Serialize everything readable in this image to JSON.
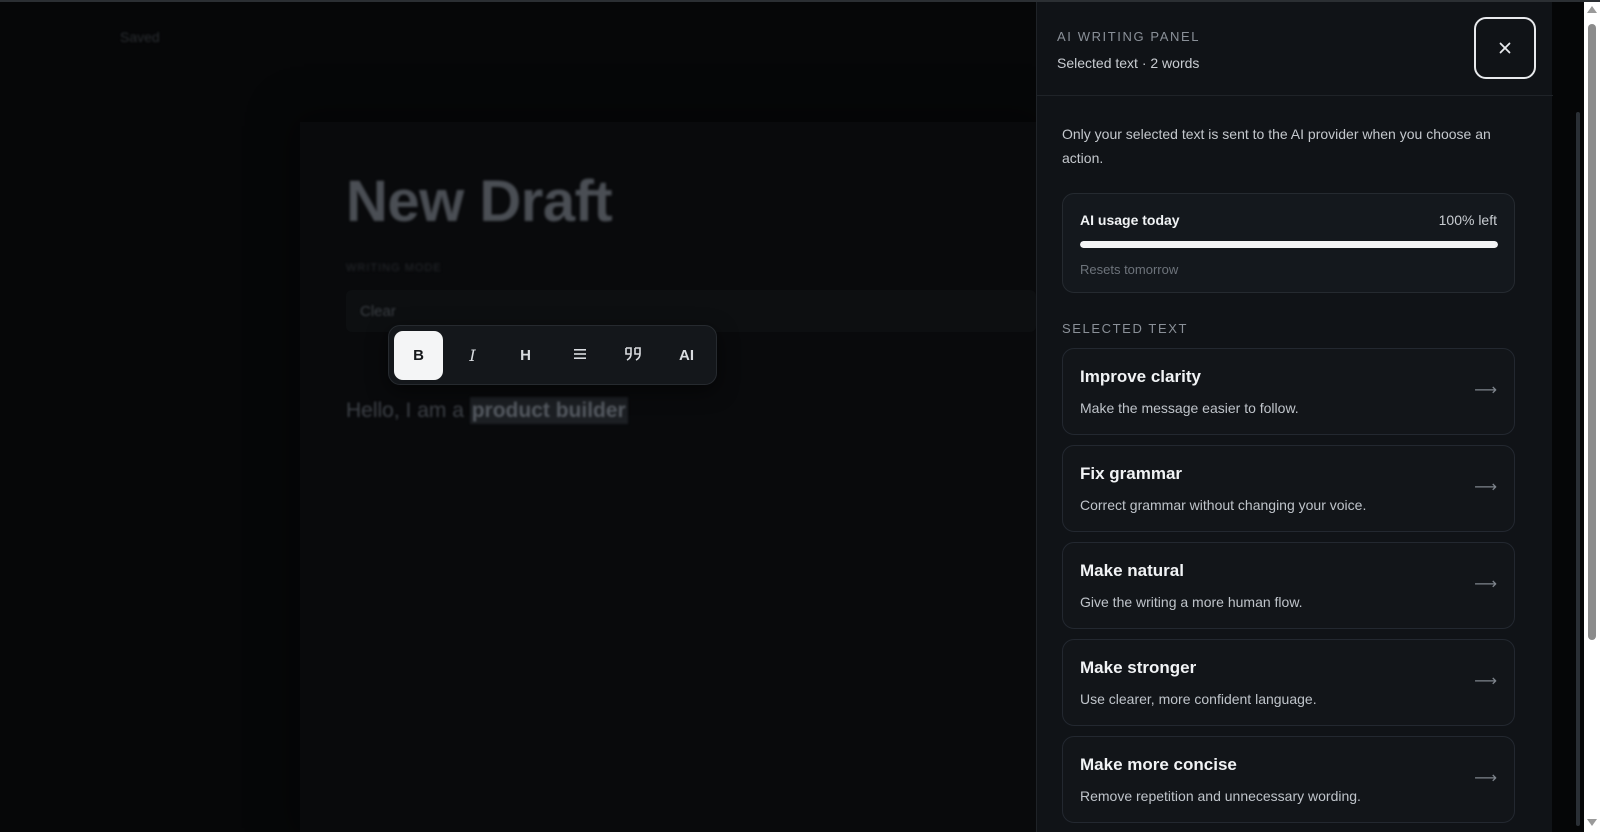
{
  "editor": {
    "saved_label": "Saved",
    "title": "New Draft",
    "mode_label": "WRITING MODE",
    "clear_label": "Clear",
    "body_prefix": "Hello, I am a ",
    "body_selected": "product builder"
  },
  "toolbar": {
    "bold_label": "B",
    "italic_label": "I",
    "heading_label": "H",
    "list_icon": "list-icon",
    "quote_icon": "quote-icon",
    "ai_label": "AI",
    "active_tool": "bold"
  },
  "ai_panel": {
    "title": "AI WRITING PANEL",
    "subtitle": "Selected text · 2 words",
    "close_icon": "close-icon",
    "privacy_note": "Only your selected text is sent to the AI provider when you choose an action.",
    "usage": {
      "title": "AI usage today",
      "left_text": "100% left",
      "percent_left": 100,
      "reset_text": "Resets tomorrow"
    },
    "section_label": "SELECTED TEXT",
    "actions": [
      {
        "name": "Improve clarity",
        "description": "Make the message easier to follow."
      },
      {
        "name": "Fix grammar",
        "description": "Correct grammar without changing your voice."
      },
      {
        "name": "Make natural",
        "description": "Give the writing a more human flow."
      },
      {
        "name": "Make stronger",
        "description": "Use clearer, more confident language."
      },
      {
        "name": "Make more concise",
        "description": "Remove repetition and unnecessary wording."
      }
    ]
  },
  "colors": {
    "background": "#050607",
    "panel": "#101317",
    "card": "#121519",
    "accent": "#f4f5f6"
  }
}
